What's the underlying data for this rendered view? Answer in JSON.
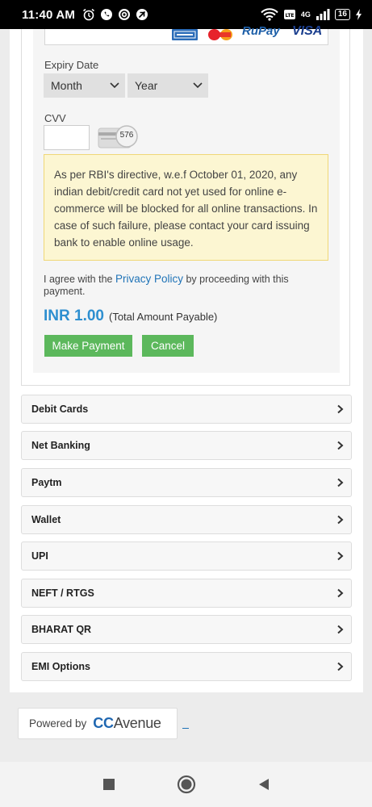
{
  "status_bar": {
    "time": "11:40 AM",
    "battery": "16",
    "network": "4G"
  },
  "card_brands": [
    "AMEX",
    "MasterCard",
    "RuPay",
    "VISA"
  ],
  "form": {
    "expiry_label": "Expiry Date",
    "month_select": "Month",
    "year_select": "Year",
    "cvv_label": "CVV",
    "cvv_value": "",
    "cvv_card_hint": "576",
    "notice": "As per RBI's directive, w.e.f October 01, 2020, any indian debit/credit card not yet used for online e-commerce will be blocked for all online transactions. In case of such failure, please contact your card issuing bank to enable online usage.",
    "agree_prefix": "I agree with the ",
    "agree_link": "Privacy Policy",
    "agree_suffix": " by proceeding with this payment.",
    "amount_value": "INR 1.00",
    "amount_note": "(Total Amount Payable)",
    "make_payment_label": "Make Payment",
    "cancel_label": "Cancel"
  },
  "payment_options": [
    {
      "label": "Debit Cards"
    },
    {
      "label": "Net Banking"
    },
    {
      "label": "Paytm"
    },
    {
      "label": "Wallet"
    },
    {
      "label": "UPI"
    },
    {
      "label": "NEFT / RTGS"
    },
    {
      "label": "BHARAT QR"
    },
    {
      "label": "EMI Options"
    }
  ],
  "footer": {
    "powered_by": "Powered by",
    "brand_cc": "CC",
    "brand_avenue": "Avenue"
  },
  "colors": {
    "button_green": "#5cb85c",
    "link_blue": "#1f73b7",
    "amount_blue": "#2e8fd0",
    "notice_bg": "#fcf6d2"
  }
}
